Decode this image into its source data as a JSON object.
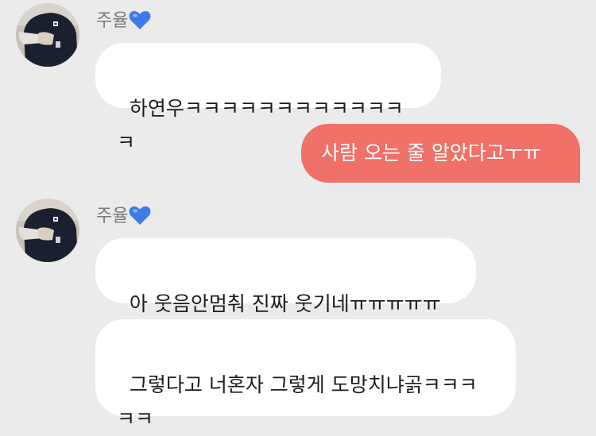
{
  "chat": {
    "background_color": "#ebebeb",
    "incoming_bubble_color": "#ffffff",
    "outgoing_bubble_color": "#f07168",
    "groups": [
      {
        "sender": "주율",
        "sender_badge_icon": "blue-heart-icon",
        "avatar_icon": "profile-photo-person-in-navy-shirt",
        "messages": [
          "하연우ㅋㅋㅋㅋㅋㅋㅋㅋㅋㅋㅋㅋㅋ"
        ]
      },
      {
        "sender": "me",
        "messages": [
          "사람 오는 줄 알았다고ㅜㅠ"
        ]
      },
      {
        "sender": "주율",
        "sender_badge_icon": "blue-heart-icon",
        "avatar_icon": "profile-photo-person-in-navy-shirt",
        "messages": [
          "아 웃음안멈춰 진짜 웃기네ㅠㅠㅠㅠㅠ",
          "그렇다고 너혼자 그렇게 도망치냐곩ㅋㅋㅋㅋㅋ"
        ]
      }
    ]
  }
}
